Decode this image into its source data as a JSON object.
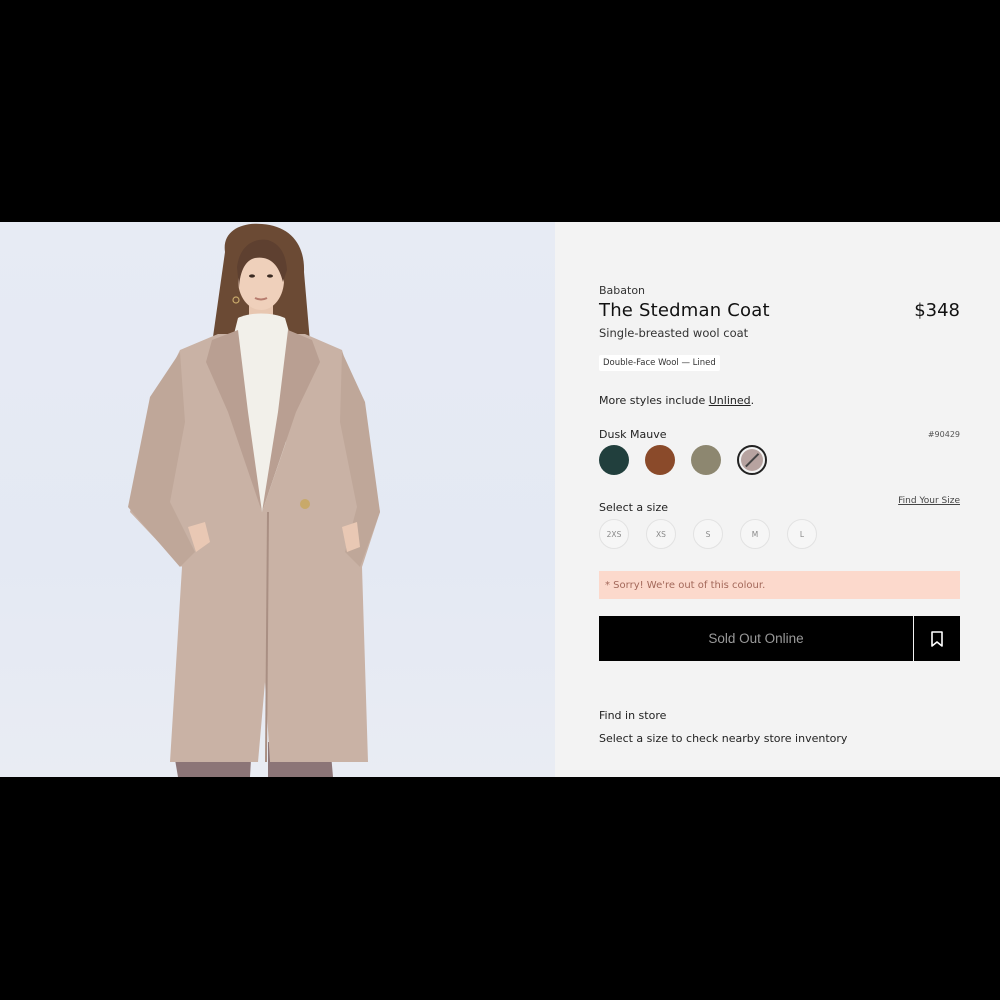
{
  "product": {
    "brand": "Babaton",
    "title": "The Stedman Coat",
    "price": "$348",
    "subtitle": "Single-breasted wool coat",
    "fabric_tag": "Double-Face Wool — Lined",
    "more_styles_prefix": "More styles include ",
    "more_styles_link": "Unlined",
    "more_styles_suffix": "."
  },
  "colour": {
    "selected_name": "Dusk Mauve",
    "sku": "#90429",
    "swatches": [
      {
        "name": "dark-teal",
        "hex": "#213f3d",
        "selected": false
      },
      {
        "name": "rust-brown",
        "hex": "#8a4a2a",
        "selected": false
      },
      {
        "name": "olive-khaki",
        "hex": "#8d8770",
        "selected": false
      },
      {
        "name": "dusk-mauve",
        "hex": "#b7a3a0",
        "selected": true
      }
    ]
  },
  "size": {
    "label": "Select a size",
    "find_link": "Find Your Size",
    "options": [
      "2XS",
      "XS",
      "S",
      "M",
      "L"
    ]
  },
  "alert": {
    "text": "* Sorry! We're out of this colour.",
    "bg": "#fcd9cc"
  },
  "actions": {
    "primary_label": "Sold Out Online",
    "save_icon": "bookmark-icon"
  },
  "store": {
    "title": "Find in store",
    "subtitle": "Select a size to check nearby store inventory"
  }
}
